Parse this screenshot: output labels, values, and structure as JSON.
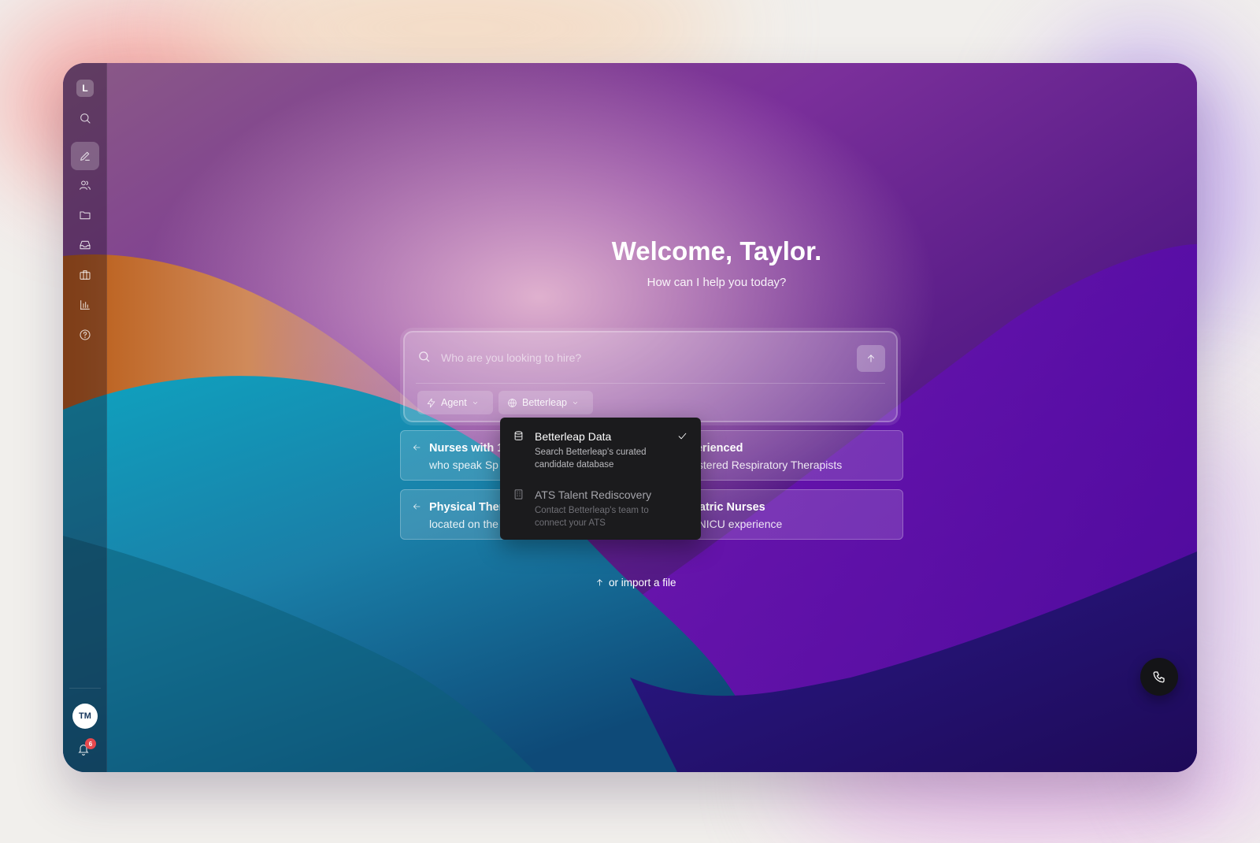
{
  "app": {
    "logo_letter": "L",
    "colors": {
      "accent_dark": "#1b1b1d",
      "badge": "#e5484d",
      "bg_purple": "#4a1d78",
      "bg_teal": "#1c8fa6",
      "bg_orange": "#c9742a"
    }
  },
  "sidebar": {
    "items": [
      {
        "icon": "search-icon"
      },
      {
        "icon": "pencil-icon",
        "active": true
      },
      {
        "icon": "users-icon"
      },
      {
        "icon": "folder-icon"
      },
      {
        "icon": "inbox-icon"
      },
      {
        "icon": "briefcase-icon"
      },
      {
        "icon": "bar-chart-icon"
      },
      {
        "icon": "help-circle-icon"
      }
    ],
    "user_initials": "TM",
    "notification_count": "6"
  },
  "main": {
    "title": "Welcome, Taylor.",
    "subtitle": "How can I help you today?",
    "search": {
      "placeholder": "Who are you looking to hire?",
      "mode_label": "Agent",
      "source_label": "Betterleap"
    },
    "suggestions": [
      {
        "title": "Nurses with 1",
        "subtitle": "who speak Sp"
      },
      {
        "title": "perienced",
        "subtitle": "gistered Respiratory Therapists"
      },
      {
        "title": "Physical Ther",
        "subtitle": "located on the"
      },
      {
        "title": "diatric Nurses",
        "subtitle": "n NICU experience"
      }
    ],
    "import_label": "or import a file"
  },
  "source_dropdown": {
    "options": [
      {
        "title": "Betterleap Data",
        "description": "Search Betterleap's curated candidate database",
        "selected": true,
        "icon": "database-icon"
      },
      {
        "title": "ATS Talent Rediscovery",
        "description": "Contact Betterleap's team to connect your ATS",
        "selected": false,
        "icon": "building-icon"
      }
    ]
  }
}
